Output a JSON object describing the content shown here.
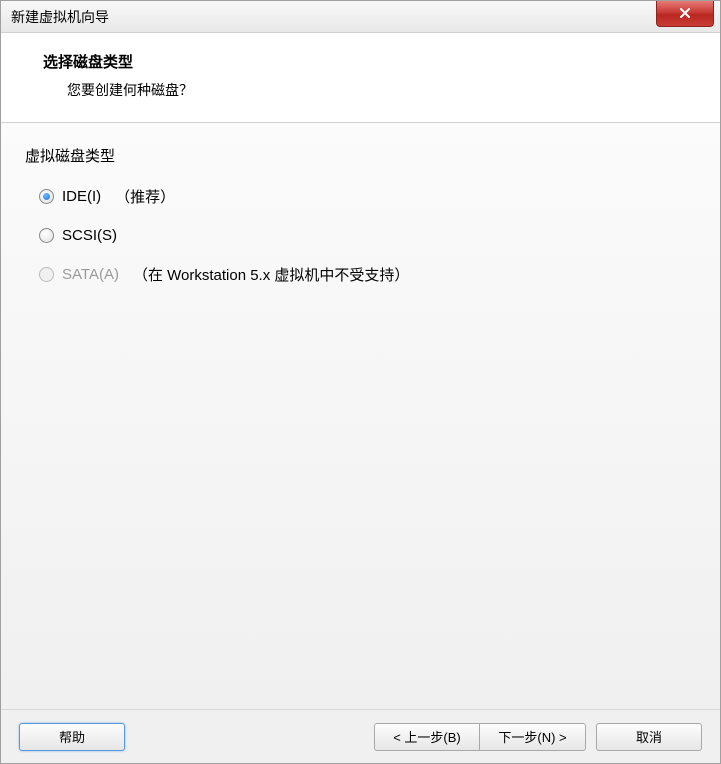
{
  "titlebar": {
    "title": "新建虚拟机向导"
  },
  "header": {
    "title": "选择磁盘类型",
    "subtitle": "您要创建何种磁盘？"
  },
  "content": {
    "group_label": "虚拟磁盘类型",
    "options": [
      {
        "label": "IDE(I)",
        "note": "（推荐）",
        "selected": true,
        "disabled": false
      },
      {
        "label": "SCSI(S)",
        "note": "",
        "selected": false,
        "disabled": false
      },
      {
        "label": "SATA(A)",
        "note": "（在 Workstation 5.x 虚拟机中不受支持）",
        "selected": false,
        "disabled": true
      }
    ]
  },
  "footer": {
    "help": "帮助",
    "back": "< 上一步(B)",
    "next": "下一步(N) >",
    "cancel": "取消"
  }
}
